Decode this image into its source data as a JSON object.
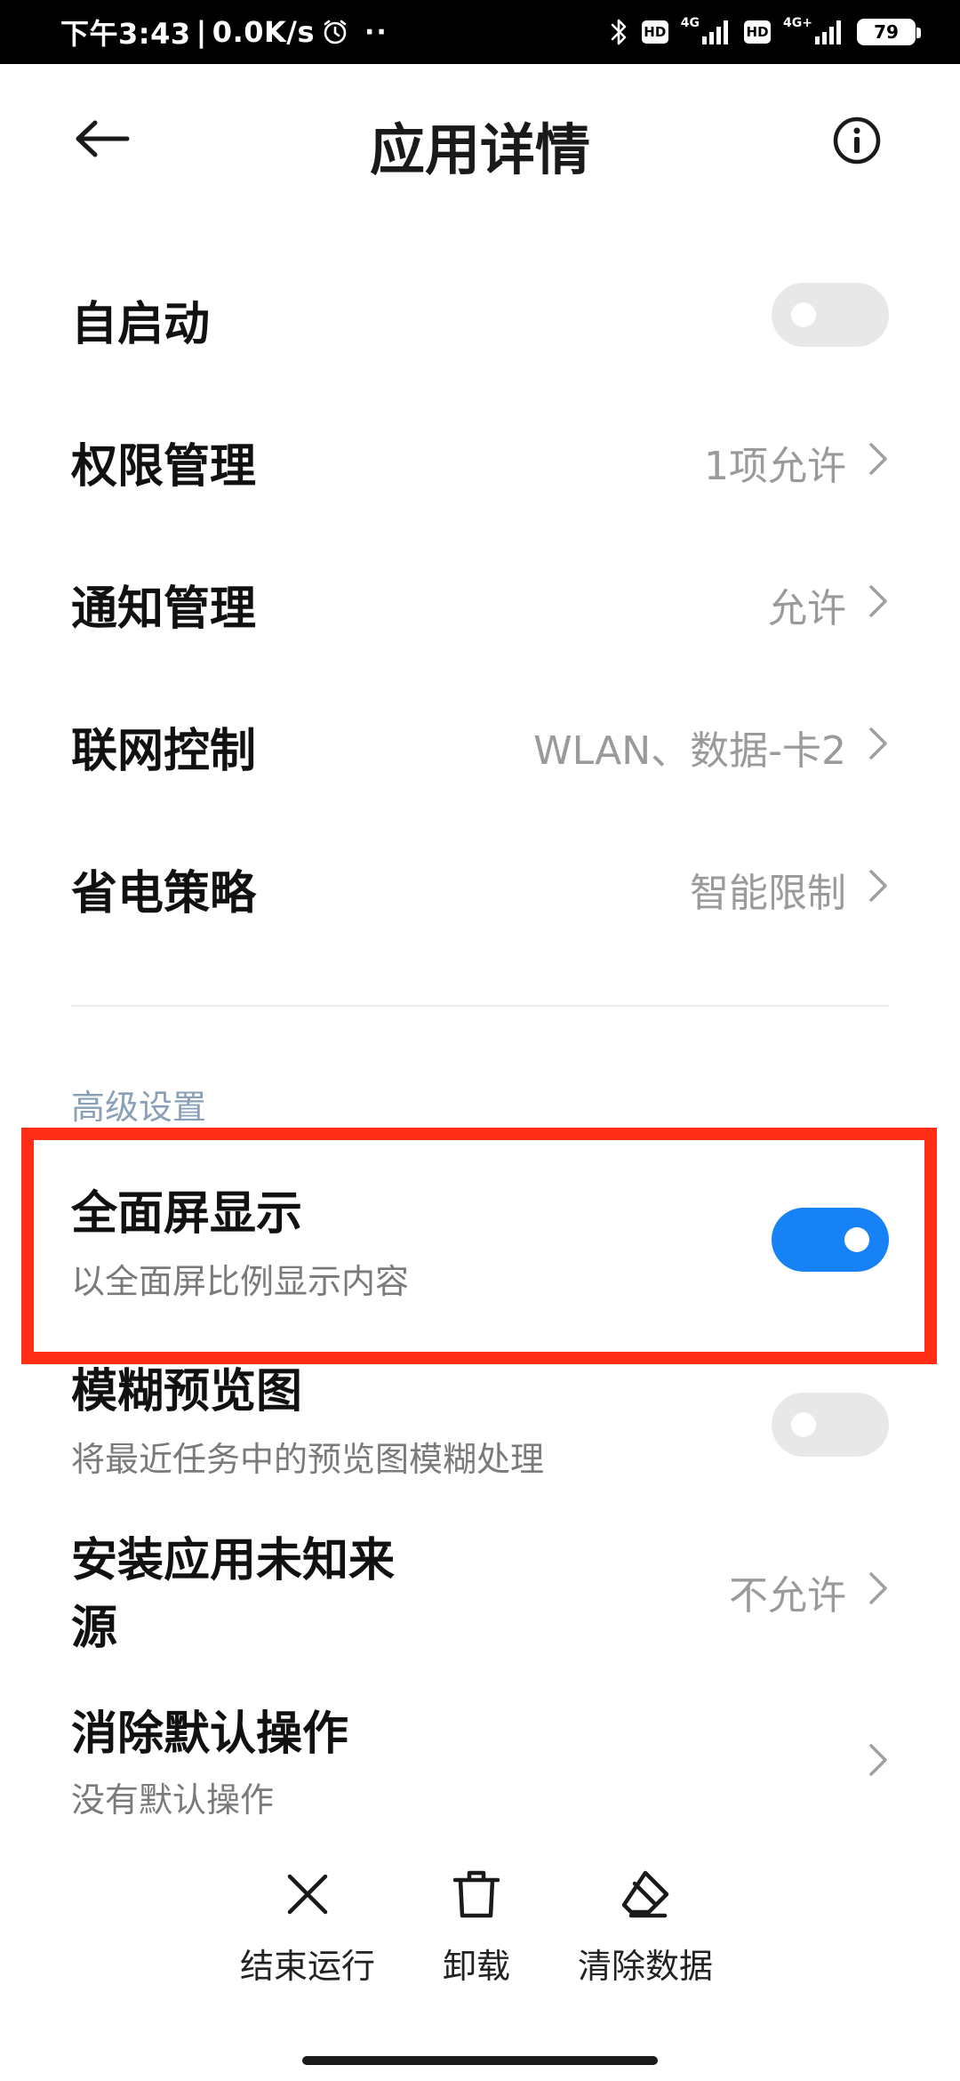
{
  "status_bar": {
    "time": "下午3:43",
    "separator": "|",
    "speed": "0.0K/s",
    "extra_dots": "··",
    "hd1": "HD",
    "net1": "4G",
    "hd2": "HD",
    "net2": "4G+",
    "battery": "79",
    "icons": [
      "alarm-icon",
      "bluetooth-icon",
      "signal-icon",
      "battery-icon"
    ]
  },
  "header": {
    "title": "应用详情",
    "back_icon": "arrow-left-icon",
    "info_icon": "info-icon"
  },
  "settings": {
    "autostart": {
      "title": "自启动",
      "enabled": false
    },
    "permissions": {
      "title": "权限管理",
      "value": "1项允许"
    },
    "notifications": {
      "title": "通知管理",
      "value": "允许"
    },
    "network": {
      "title": "联网控制",
      "value": "WLAN、数据-卡2"
    },
    "battery_saver": {
      "title": "省电策略",
      "value": "智能限制"
    }
  },
  "advanced": {
    "section_title": "高级设置",
    "fullscreen": {
      "title": "全面屏显示",
      "subtitle": "以全面屏比例显示内容",
      "enabled": true
    },
    "blur_preview": {
      "title": "模糊预览图",
      "subtitle": "将最近任务中的预览图模糊处理",
      "enabled": false
    },
    "unknown_sources": {
      "title_line1": "安装应用未知来",
      "title_line2": "源",
      "value": "不允许"
    },
    "clear_defaults": {
      "title": "消除默认操作",
      "subtitle": "没有默认操作"
    }
  },
  "actions": {
    "force_stop": "结束运行",
    "uninstall": "卸载",
    "clear_data": "清除数据"
  },
  "colors": {
    "accent": "#1682f5",
    "highlight": "#ff2d16"
  }
}
